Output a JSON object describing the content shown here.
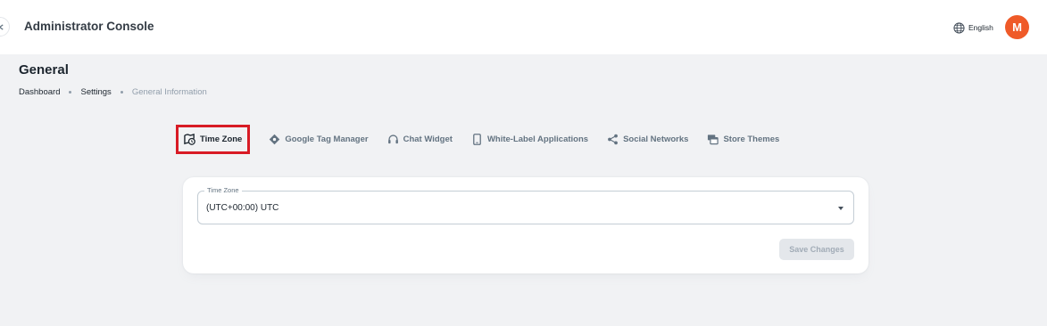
{
  "header": {
    "app_title": "Administrator Console",
    "language": "English",
    "avatar_initial": "M",
    "avatar_color": "#ef5a28"
  },
  "page": {
    "title": "General",
    "breadcrumb": [
      "Dashboard",
      "Settings",
      "General Information"
    ]
  },
  "tabs": [
    {
      "label": "Time Zone",
      "icon": "time-zone-icon",
      "active": true
    },
    {
      "label": "Google Tag Manager",
      "icon": "diamond-icon",
      "active": false
    },
    {
      "label": "Chat Widget",
      "icon": "headset-icon",
      "active": false
    },
    {
      "label": "White-Label Applications",
      "icon": "phone-icon",
      "active": false
    },
    {
      "label": "Social Networks",
      "icon": "share-icon",
      "active": false
    },
    {
      "label": "Store Themes",
      "icon": "layers-icon",
      "active": false
    }
  ],
  "timezone_form": {
    "field_label": "Time Zone",
    "selected_value": "(UTC+00:00) UTC",
    "save_label": "Save Changes"
  },
  "colors": {
    "highlight_border": "#d81b25",
    "page_bg": "#f1f2f4"
  }
}
